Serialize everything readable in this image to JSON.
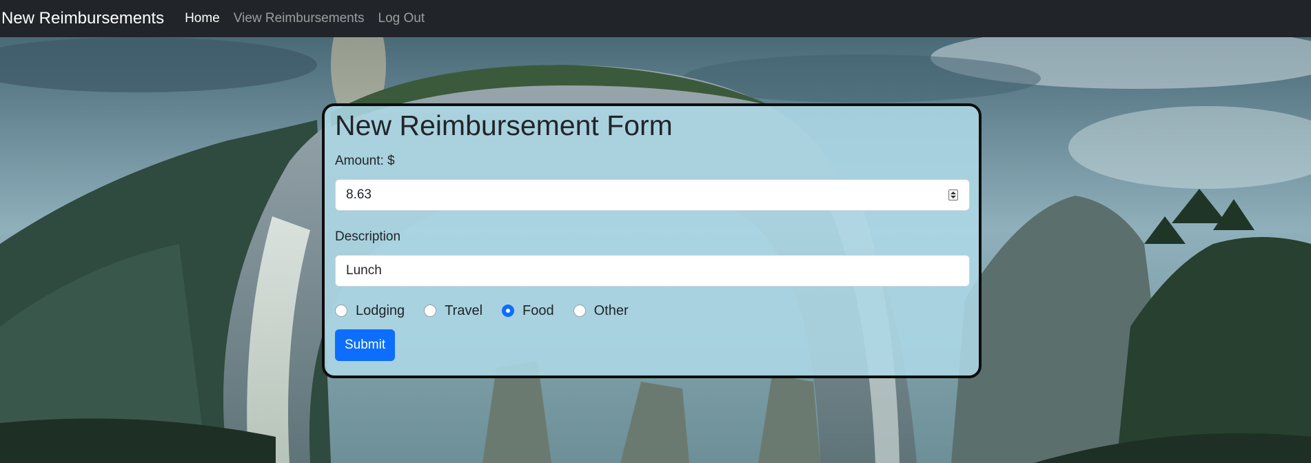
{
  "navbar": {
    "brand": "New Reimbursements",
    "links": [
      {
        "label": "Home",
        "active": true
      },
      {
        "label": "View Reimbursements",
        "active": false
      },
      {
        "label": "Log Out",
        "active": false
      }
    ]
  },
  "form": {
    "title": "New Reimbursement Form",
    "amount_label": "Amount: $",
    "amount_value": "8.63",
    "description_label": "Description",
    "description_value": "Lunch",
    "types": [
      {
        "label": "Lodging",
        "checked": false
      },
      {
        "label": "Travel",
        "checked": false
      },
      {
        "label": "Food",
        "checked": true
      },
      {
        "label": "Other",
        "checked": false
      }
    ],
    "submit_label": "Submit"
  },
  "colors": {
    "navbar_bg": "#212529",
    "card_bg": "#add8e6",
    "primary": "#0d6efd"
  }
}
